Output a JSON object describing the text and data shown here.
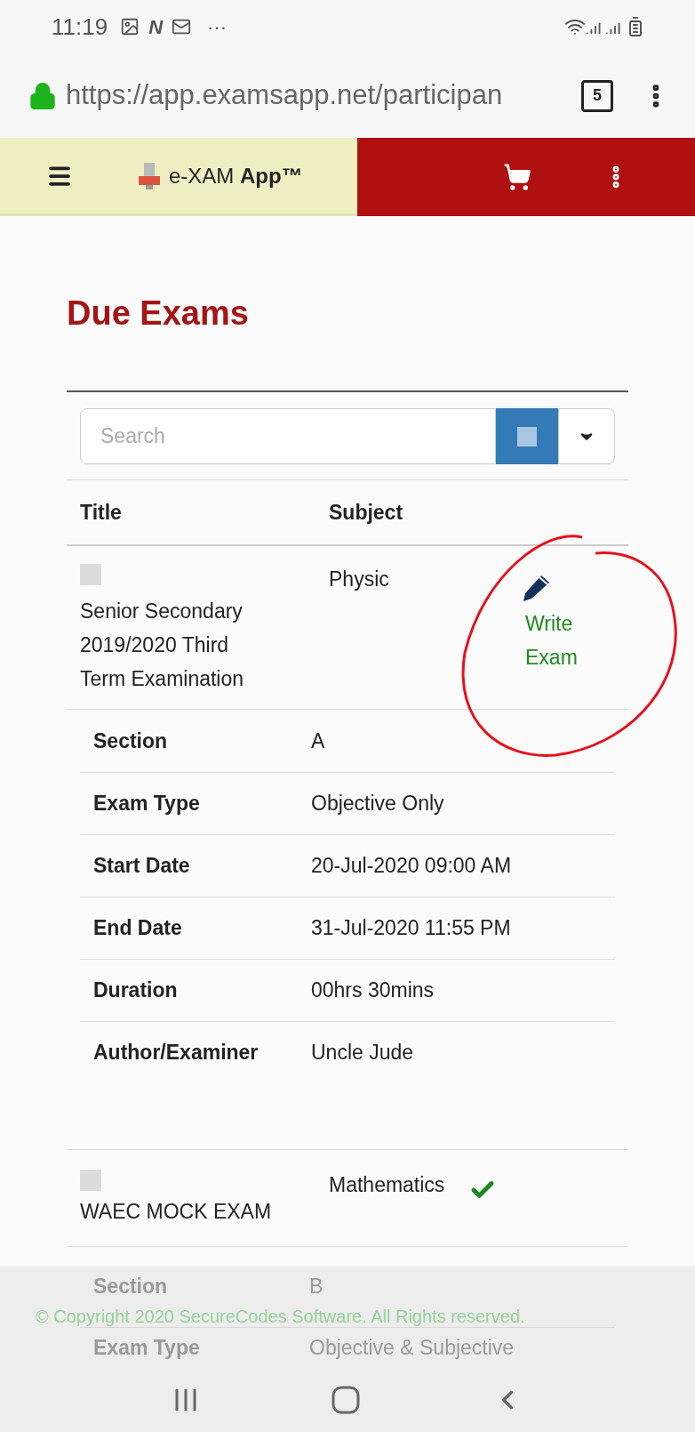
{
  "status_bar": {
    "time": "11:19",
    "app_glyph": "N",
    "overflow": "···"
  },
  "browser": {
    "url": "https://app.examsapp.net/participan",
    "tab_count": "5"
  },
  "app_bar": {
    "brand": "e-XAM **App™**"
  },
  "page_title": "Due Exams",
  "search": {
    "placeholder": "Search"
  },
  "table": {
    "columns": [
      "Title",
      "Subject"
    ],
    "exams": [
      {
        "title": "Senior Secondary 2019/2020 Third Term Examination",
        "subject": "Physic",
        "checked": false,
        "action": {
          "kind": "write",
          "label": "Write Exam"
        },
        "details": [
          {
            "label": "Section",
            "value": "A"
          },
          {
            "label": "Exam Type",
            "value": "Objective Only"
          },
          {
            "label": "Start Date",
            "value": "20-Jul-2020 09:00 AM"
          },
          {
            "label": "End Date",
            "value": "31-Jul-2020 11:55 PM"
          },
          {
            "label": "Duration",
            "value": "00hrs 30mins"
          },
          {
            "label": "Author/Examiner",
            "value": "Uncle Jude"
          }
        ]
      },
      {
        "title": "WAEC MOCK EXAM",
        "subject": "Mathematics",
        "checked": false,
        "action": {
          "kind": "done"
        },
        "details": [
          {
            "label": "Section",
            "value": "B"
          },
          {
            "label": "Exam Type",
            "value": "Objective & Subjective"
          }
        ]
      }
    ]
  },
  "footer": {
    "copyright": "© Copyright 2020 SecureCodes Software. All Rights reserved."
  }
}
